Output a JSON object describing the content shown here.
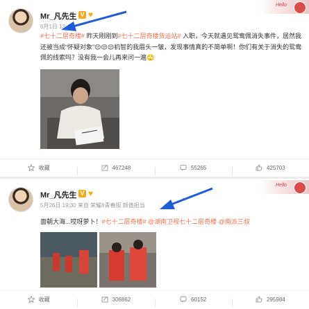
{
  "posts": [
    {
      "author": "Mr_凡先生",
      "verified_badge": "V",
      "time": "6月1日 13:43",
      "source": "",
      "text_segments": [
        {
          "t": "#七十二层奇楼#",
          "tag": true
        },
        {
          "t": " 昨天刚刚到",
          "tag": false
        },
        {
          "t": "#七十二层奇楼货运站#",
          "tag": true
        },
        {
          "t": " 入职，今天就遇见鸳鸯佩消失事件，居然我还被当成“怀疑对象”😒😒😒机智的我眉头一皱，发现事情真的不简单啊！你们有关于消失的鸳鸯佩的线索吗？没有我一会儿再来问一遍🙄",
          "tag": false
        }
      ],
      "actions": {
        "favorite_label": "收藏",
        "repost_count": "467248",
        "comment_count": "55265",
        "like_count": "425703"
      }
    },
    {
      "author": "Mr_凡先生",
      "verified_badge": "V",
      "time": "5月26日 19:30",
      "source": "来自 荣耀8青春版 颜值担当",
      "text_segments": [
        {
          "t": "面朝大海...哎呀萝卜！",
          "tag": false
        },
        {
          "t": "#七十二层奇楼#",
          "tag": true
        },
        {
          "t": " @湖南卫视七十二层奇楼",
          "tag": true
        },
        {
          "t": " @南派三叔",
          "tag": true
        }
      ],
      "actions": {
        "favorite_label": "收藏",
        "repost_count": "306862",
        "comment_count": "60152",
        "like_count": "295984"
      }
    }
  ],
  "decoration_text": "Hello",
  "colors": {
    "accent": "#eb7350",
    "arrow": "#1f5bd6",
    "verified": "#f7a81b"
  },
  "icons": [
    "star-icon",
    "repost-icon",
    "comment-icon",
    "like-icon",
    "heart-icon",
    "verified-icon"
  ]
}
